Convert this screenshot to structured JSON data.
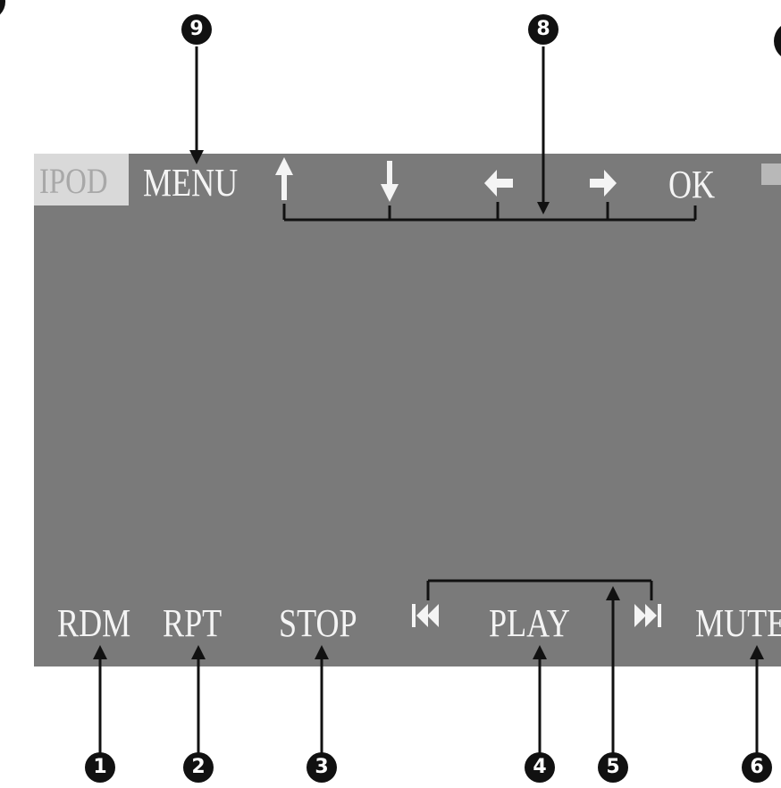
{
  "screen": {
    "top_labels": {
      "ipod": "IPOD",
      "menu": "MENU",
      "ok": "OK"
    },
    "bottom_labels": {
      "rdm": "RDM",
      "rpt": "RPT",
      "stop": "STOP",
      "play": "PLAY",
      "mute": "MUTE"
    },
    "icons": [
      "arrow-up-icon",
      "arrow-down-icon",
      "arrow-left-icon",
      "arrow-right-icon",
      "previous-track-icon",
      "next-track-icon"
    ]
  },
  "callouts": {
    "c1": "1",
    "c2": "2",
    "c3": "3",
    "c4": "4",
    "c5": "5",
    "c6": "6",
    "c8": "8",
    "c9": "9"
  },
  "colors": {
    "screen": "#7a7a7a",
    "label": "#f4f4f4",
    "ipod_box": "#d9d9d9",
    "callout": "#111111"
  }
}
